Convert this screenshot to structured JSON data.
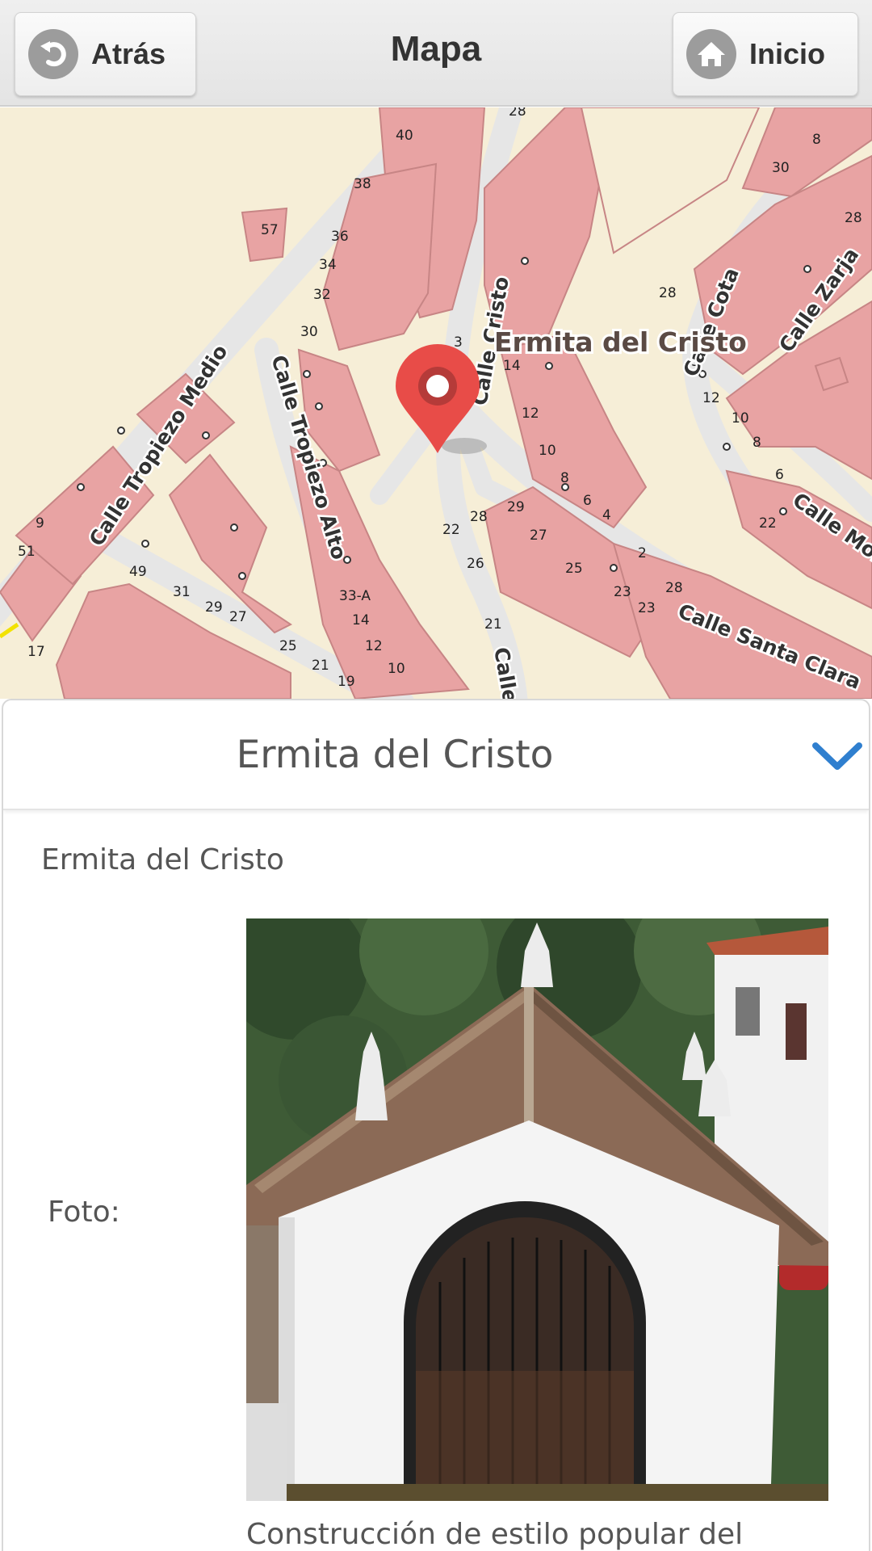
{
  "header": {
    "title": "Mapa",
    "back_label": "Atrás",
    "home_label": "Inicio"
  },
  "map": {
    "poi_label": "Ermita del Cristo",
    "marker_color": "#e84c48",
    "streets": [
      "Calle Cristo",
      "Calle Cota",
      "Calle Zarja",
      "Calle Tropiezo Medio",
      "Calle Tropiezo Alto",
      "Calle Santa Clara",
      "Calle Mon",
      "Calle"
    ],
    "house_numbers": [
      "28",
      "40",
      "38",
      "57",
      "36",
      "34",
      "32",
      "30",
      "3",
      "14",
      "12",
      "10",
      "8",
      "6",
      "4",
      "2",
      "28",
      "29",
      "27",
      "26",
      "25",
      "23",
      "21",
      "22",
      "9",
      "51",
      "49",
      "31",
      "29",
      "27",
      "25",
      "21",
      "19",
      "17",
      "33-A",
      "14",
      "12",
      "10",
      "8",
      "30",
      "28",
      "28",
      "3",
      "12",
      "10",
      "8",
      "6",
      "22",
      "4"
    ]
  },
  "panel": {
    "title": "Ermita del Cristo",
    "subtitle": "Ermita del Cristo",
    "photo_label": "Foto:",
    "description": "Construcción de estilo popular del"
  }
}
